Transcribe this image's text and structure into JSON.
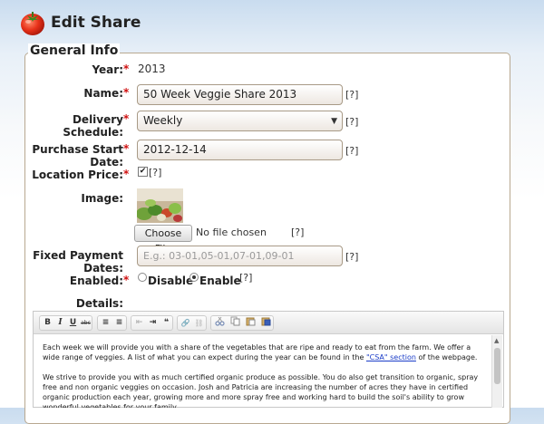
{
  "header": {
    "title": "Edit Share",
    "logo_icon": "tomato-icon"
  },
  "fieldset": {
    "legend": "General Info"
  },
  "form": {
    "year": {
      "label": "Year:",
      "required": "*",
      "value": "2013"
    },
    "name": {
      "label": "Name:",
      "required": "*",
      "value": "50 Week Veggie Share 2013",
      "help": "[?]"
    },
    "delivery_schedule": {
      "label": "Delivery Schedule:",
      "required": "*",
      "selected": "Weekly",
      "help": "[?]"
    },
    "purchase_start_date": {
      "label": "Purchase Start Date:",
      "required": "*",
      "value": "2012-12-14",
      "help": "[?]"
    },
    "location_price": {
      "label": "Location Price:",
      "required": "*",
      "checked": "✔",
      "help": "[?]"
    },
    "image": {
      "label": "Image:",
      "choose_file": "Choose File",
      "file_status": "No file chosen",
      "help": "[?]"
    },
    "fixed_payment_dates": {
      "label": "Fixed Payment Dates:",
      "placeholder": "E.g.: 03-01,05-01,07-01,09-01",
      "help": "[?]"
    },
    "enabled": {
      "label": "Enabled:",
      "required": "*",
      "option_disable": "Disable",
      "option_enable": "Enable",
      "selected": "Enable",
      "help": "[?]"
    },
    "details": {
      "label": "Details:"
    }
  },
  "editor": {
    "toolbar": {
      "bold": "B",
      "italic": "I",
      "underline": "U",
      "strikethrough": "abc",
      "numbered_list": "≡",
      "bulleted_list": "≡",
      "outdent": "⇤",
      "indent": "⇥",
      "blockquote": "❝",
      "link": "🔗",
      "unlink": "⛓"
    },
    "content": {
      "p1_before_link": "Each week we will provide you with a share of the vegetables that are ripe and ready to eat from the farm. We offer a wide range of veggies. A list of what you can expect during the year can be found in the ",
      "p1_link": "\"CSA\" section",
      "p1_after_link": " of the webpage.",
      "p2": "We strive to provide you with as much certified organic produce as possible. You do also get transition to organic, spray free and non organic veggies on occasion. Josh and Patricia are increasing the number of acres they have in certified organic production each year, growing more and more spray free and working hard to build the soil's ability to grow wonderful vegetables for your family."
    }
  }
}
